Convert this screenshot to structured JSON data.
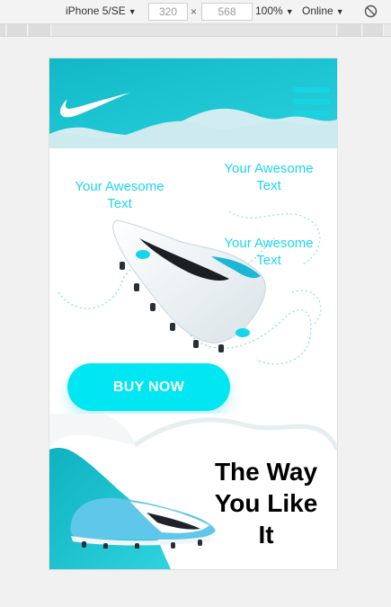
{
  "devtools": {
    "device": "iPhone 5/SE",
    "width": "320",
    "times": "×",
    "height": "568",
    "zoom": "100%",
    "network": "Online"
  },
  "page": {
    "awesome_text": [
      "Your Awesome Text",
      "Your Awesome Text",
      "Your Awesome Text"
    ],
    "buy_button": "BUY NOW",
    "tagline": "The Way You Like It"
  },
  "icons": {
    "logo": "nike-swoosh-icon",
    "menu": "hamburger-menu-icon",
    "rotate": "rotate-icon"
  },
  "colors": {
    "accent": "#19d3e3",
    "header": "#1cc5d3",
    "button": "#00e6f2"
  }
}
